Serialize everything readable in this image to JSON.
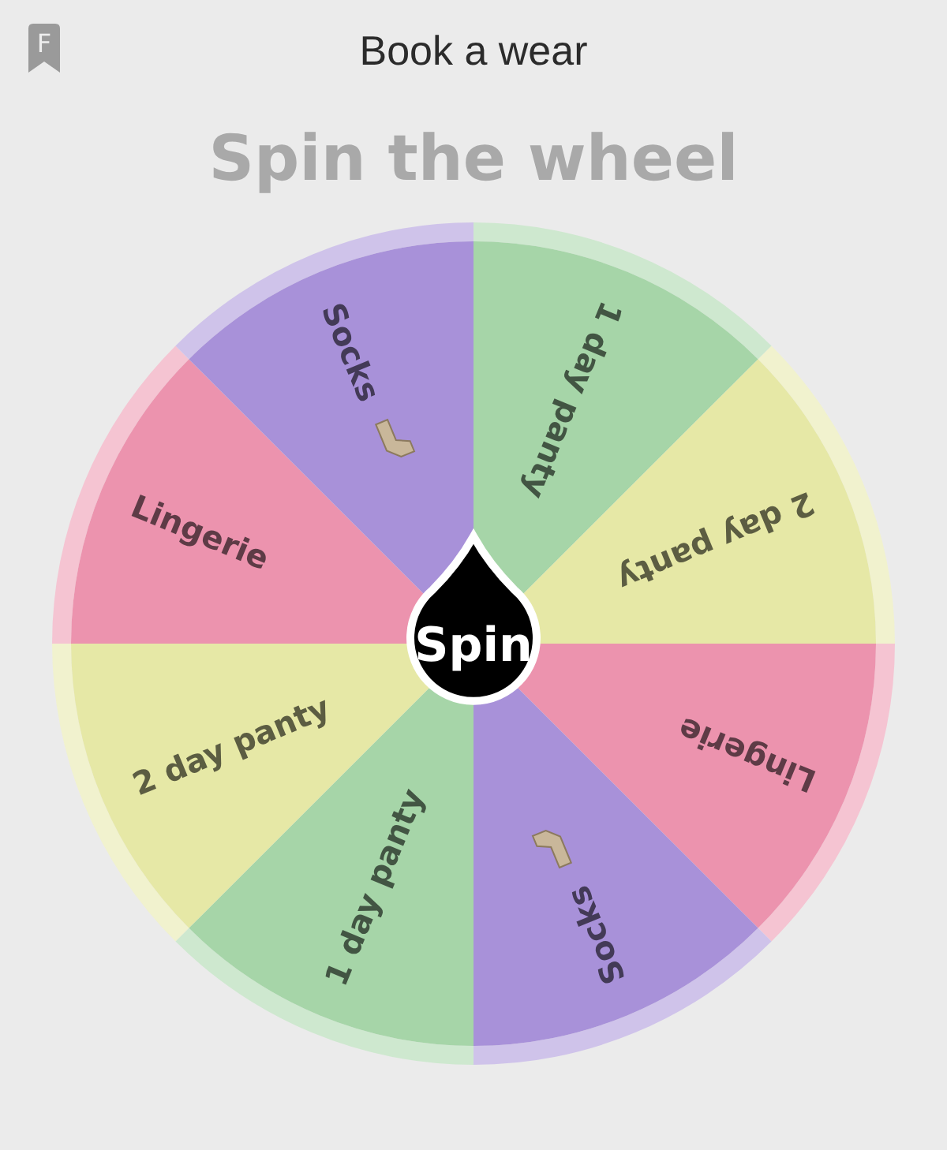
{
  "header": {
    "badge": "F",
    "title": "Book a wear"
  },
  "heading": "Spin the wheel",
  "wheel": {
    "segments": [
      {
        "label": "1 day panty",
        "color": "#a6d5a8",
        "kind": "text"
      },
      {
        "label": "2 day panty",
        "color": "#e6e8a6",
        "kind": "text"
      },
      {
        "label": "Lingerie",
        "color": "#ec93ae",
        "kind": "text"
      },
      {
        "label": "Socks",
        "color": "#a891d9",
        "kind": "with-icon"
      },
      {
        "label": "1 day panty",
        "color": "#a6d5a8",
        "kind": "text"
      },
      {
        "label": "2 day panty",
        "color": "#e6e8a6",
        "kind": "text"
      },
      {
        "label": "Lingerie",
        "color": "#ec93ae",
        "kind": "text"
      },
      {
        "label": "Socks",
        "color": "#a891d9",
        "kind": "with-icon"
      }
    ],
    "button": "Spin"
  }
}
